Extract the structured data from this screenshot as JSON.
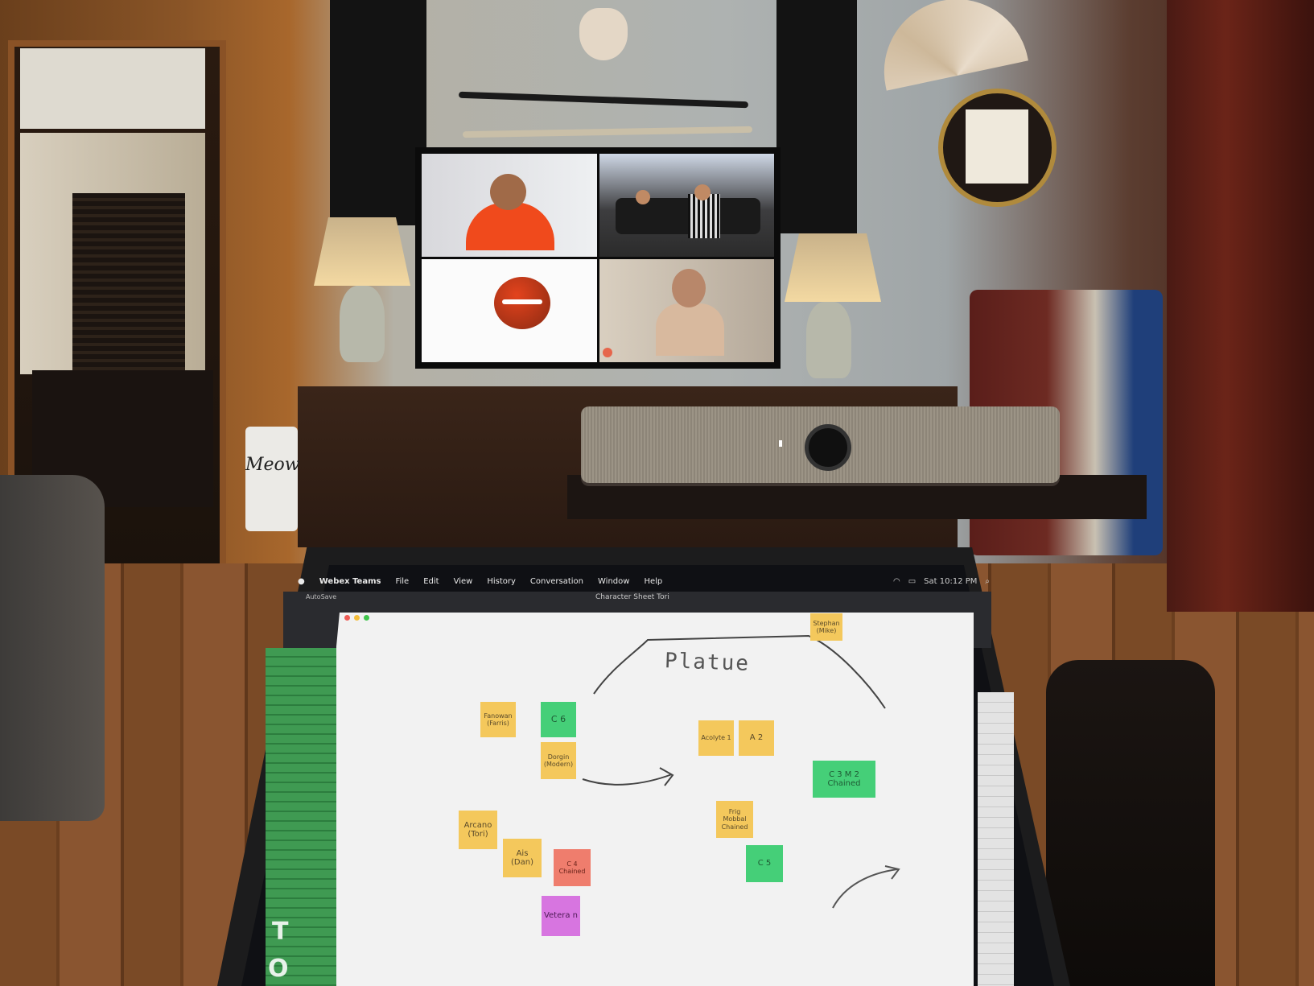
{
  "bin_label": "Meow",
  "laptop": {
    "menubar": {
      "app_name": "Webex Teams",
      "menus": [
        "File",
        "Edit",
        "View",
        "History",
        "Conversation",
        "Window",
        "Help"
      ],
      "clock": "Sat 10:12 PM"
    },
    "excel": {
      "autosave": "AutoSave",
      "document_title": "Character Sheet Tori",
      "sidebar_letters": [
        "T",
        "O"
      ]
    },
    "whiteboard": {
      "heading": "Platue",
      "notes": [
        {
          "text": "Stephan (Mike)",
          "color": "yellow"
        },
        {
          "text": "Fanowan (Farris)",
          "color": "yellow"
        },
        {
          "text": "C 6",
          "color": "green"
        },
        {
          "text": "Dorgin (Modern)",
          "color": "yellow"
        },
        {
          "text": "Acolyte 1",
          "color": "yellow"
        },
        {
          "text": "A 2",
          "color": "yellow"
        },
        {
          "text": "C 3  M 2 Chained",
          "color": "green"
        },
        {
          "text": "Arcano (Tori)",
          "color": "yellow"
        },
        {
          "text": "Ais (Dan)",
          "color": "yellow"
        },
        {
          "text": "C 4 Chained",
          "color": "red"
        },
        {
          "text": "Frig Mobbal Chained",
          "color": "yellow"
        },
        {
          "text": "C 5",
          "color": "green"
        },
        {
          "text": "Vetera n",
          "color": "purple"
        }
      ]
    }
  },
  "colors": {
    "sticky_yellow": "#f4c85c",
    "sticky_green": "#45cf78",
    "sticky_red": "#ef7d6d",
    "sticky_purple": "#d775e0",
    "excel_green": "#2c7d3e"
  }
}
